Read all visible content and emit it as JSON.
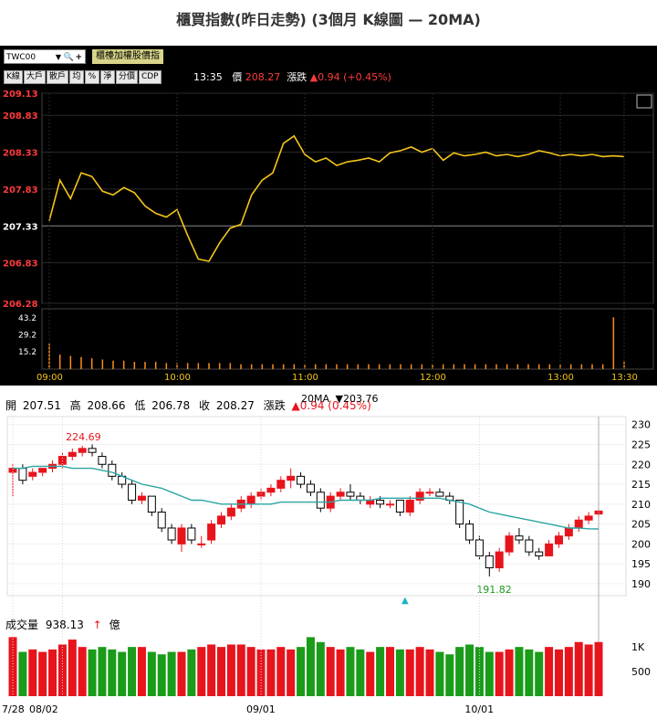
{
  "title": "櫃買指數(昨日走勢) (3個月 K線圖 — 20MA)",
  "intraday": {
    "symbol": "TWC00",
    "index_name": "櫃檯加權股價指",
    "buttons": [
      "K線",
      "大戶",
      "散戶",
      "均",
      "%",
      "淨",
      "分價",
      "CDP"
    ],
    "time": "13:35",
    "price_label": "價",
    "price": "208.27",
    "change_label": "漲跌",
    "change": "▲0.94 (+0.45%)",
    "colors": {
      "line": "#f5c518",
      "red": "#ff3b3b",
      "grid": "#2a2a2a",
      "volume": "#ff8c1a"
    }
  },
  "daily": {
    "ohlc_text": {
      "open_label": "開",
      "open": "207.51",
      "high_label": "高",
      "high": "208.66",
      "low_label": "低",
      "low": "206.78",
      "close_label": "收",
      "close": "208.27",
      "change_label": "漲跌",
      "change": "▲0.94 (0.45%)"
    },
    "ma_label": "20MA",
    "ma_value": "▼203.76",
    "volume_label": "成交量",
    "volume_value": "938.13",
    "volume_unit": "億",
    "colors": {
      "up": "#e8141c",
      "down": "#1a9c1a",
      "ma": "#2aa4a4"
    }
  },
  "chart_data": [
    {
      "type": "line",
      "title": "",
      "x_ticks": [
        "09:00",
        "10:00",
        "11:00",
        "12:00",
        "13:00",
        "13:30"
      ],
      "y_ticks": [
        "209.13",
        "208.83",
        "208.33",
        "207.83",
        "207.33",
        "206.83",
        "206.28"
      ],
      "reference": 207.33,
      "ylim": [
        206.28,
        209.13
      ],
      "x": [
        0,
        5,
        10,
        15,
        20,
        25,
        30,
        35,
        40,
        45,
        50,
        55,
        60,
        65,
        70,
        75,
        80,
        85,
        90,
        95,
        100,
        105,
        110,
        115,
        120,
        125,
        130,
        135,
        140,
        145,
        150,
        155,
        160,
        165,
        170,
        175,
        180,
        185,
        190,
        195,
        200,
        205,
        210,
        215,
        220,
        225,
        230,
        235,
        240,
        245,
        250,
        255,
        260,
        265,
        270
      ],
      "values": [
        207.4,
        207.95,
        207.7,
        208.05,
        208.0,
        207.8,
        207.75,
        207.85,
        207.78,
        207.6,
        207.5,
        207.45,
        207.55,
        207.2,
        206.88,
        206.85,
        207.1,
        207.3,
        207.35,
        207.75,
        207.95,
        208.05,
        208.45,
        208.55,
        208.3,
        208.2,
        208.25,
        208.15,
        208.2,
        208.22,
        208.25,
        208.2,
        208.32,
        208.35,
        208.4,
        208.33,
        208.38,
        208.22,
        208.32,
        208.28,
        208.3,
        208.33,
        208.28,
        208.3,
        208.27,
        208.3,
        208.35,
        208.32,
        208.28,
        208.3,
        208.28,
        208.3,
        208.27,
        208.28,
        208.27
      ],
      "volume": {
        "y_ticks": [
          "43.2",
          "29.2",
          "15.2"
        ],
        "ylim": [
          0,
          50
        ],
        "values": [
          21,
          12,
          11,
          10,
          9,
          8,
          7,
          7,
          6,
          6,
          6,
          5,
          5,
          5,
          5,
          5,
          5,
          5,
          4,
          4,
          4,
          4,
          4,
          4,
          4,
          4,
          4,
          4,
          4,
          4,
          4,
          4,
          4,
          4,
          4,
          4,
          4,
          4,
          4,
          4,
          4,
          4,
          4,
          4,
          4,
          4,
          4,
          4,
          4,
          4,
          4,
          4,
          4,
          43,
          6
        ]
      }
    },
    {
      "type": "candlestick",
      "title": "",
      "x_ticks": [
        "7/28",
        "08/02",
        "09/01",
        "10/01"
      ],
      "y_ticks": [
        "230",
        "225",
        "220",
        "215",
        "210",
        "205",
        "200",
        "195",
        "190"
      ],
      "ylim": [
        187,
        232
      ],
      "annotations": [
        {
          "label": "224.69",
          "value": 224.69
        },
        {
          "label": "191.82",
          "value": 191.82
        }
      ],
      "candles": [
        [
          218,
          220,
          212,
          219
        ],
        [
          219,
          220,
          215,
          216
        ],
        [
          217,
          219,
          216,
          218
        ],
        [
          218,
          219,
          217,
          219
        ],
        [
          219,
          221,
          218,
          220
        ],
        [
          220,
          223,
          219,
          222
        ],
        [
          222,
          224,
          221,
          223
        ],
        [
          223,
          224.69,
          222,
          224
        ],
        [
          224,
          225,
          222,
          223
        ],
        [
          222,
          223,
          219,
          220
        ],
        [
          220,
          221,
          216,
          217
        ],
        [
          217,
          218,
          214,
          215
        ],
        [
          215,
          216,
          210,
          211
        ],
        [
          211,
          213,
          210,
          212
        ],
        [
          212,
          212,
          207,
          208
        ],
        [
          208,
          209,
          203,
          204
        ],
        [
          204,
          205,
          200,
          201
        ],
        [
          200,
          205,
          198,
          204
        ],
        [
          204,
          205,
          200,
          201
        ],
        [
          200,
          202,
          199,
          200
        ],
        [
          201,
          206,
          200,
          205
        ],
        [
          205,
          208,
          204,
          207
        ],
        [
          207,
          210,
          206,
          209
        ],
        [
          209,
          212,
          208,
          211
        ],
        [
          210,
          213,
          209,
          212
        ],
        [
          212,
          214,
          211,
          213
        ],
        [
          213,
          215,
          212,
          214
        ],
        [
          214,
          217,
          213,
          216
        ],
        [
          216,
          219,
          214,
          217
        ],
        [
          217,
          218,
          214,
          215
        ],
        [
          215,
          216,
          212,
          213
        ],
        [
          213,
          214,
          208,
          209
        ],
        [
          209,
          213,
          208,
          212
        ],
        [
          212,
          214,
          211,
          213
        ],
        [
          213,
          215,
          211,
          212
        ],
        [
          212,
          213,
          210,
          211
        ],
        [
          210,
          212,
          209,
          211
        ],
        [
          211,
          212,
          209,
          210
        ],
        [
          210,
          211,
          209,
          210
        ],
        [
          211,
          211,
          207,
          208
        ],
        [
          208,
          212,
          207,
          211
        ],
        [
          211,
          214,
          210,
          213
        ],
        [
          213,
          214,
          212,
          213
        ],
        [
          213,
          214,
          212,
          212
        ],
        [
          212,
          213,
          210,
          211
        ],
        [
          211,
          211,
          204,
          205
        ],
        [
          205,
          206,
          200,
          201
        ],
        [
          201,
          202,
          196,
          197
        ],
        [
          197,
          198,
          191.82,
          194
        ],
        [
          194,
          199,
          193,
          198
        ],
        [
          198,
          203,
          197,
          202
        ],
        [
          202,
          204,
          200,
          201
        ],
        [
          201,
          202,
          197,
          198
        ],
        [
          198,
          199,
          196,
          197
        ],
        [
          197,
          201,
          197,
          200
        ],
        [
          200,
          203,
          199,
          202
        ],
        [
          202,
          205,
          201,
          204
        ],
        [
          204,
          207,
          203,
          206
        ],
        [
          206,
          208,
          205,
          207
        ],
        [
          207.51,
          208.66,
          206.78,
          208.27
        ]
      ],
      "ma20": [
        219,
        219,
        219.5,
        219.5,
        219.5,
        219.5,
        219,
        219,
        219,
        218.5,
        218,
        217,
        216,
        215,
        214.5,
        214,
        213,
        212,
        211,
        211,
        210.5,
        210,
        210,
        210,
        210,
        210,
        210,
        210.5,
        210.5,
        210.5,
        210.5,
        210.5,
        210.5,
        211,
        211,
        211,
        211,
        211.5,
        211.5,
        211.5,
        211.5,
        211.5,
        211.5,
        211.5,
        211,
        210.5,
        210,
        209,
        208,
        207.5,
        207,
        206.5,
        206,
        205.5,
        205,
        204.5,
        204,
        204,
        203.8,
        203.76
      ],
      "volume": {
        "y_ticks": [
          "1K",
          "500"
        ],
        "ylim": [
          0,
          1300
        ],
        "values": [
          1200,
          900,
          950,
          900,
          950,
          1050,
          1150,
          1000,
          950,
          1000,
          950,
          900,
          1000,
          1000,
          900,
          850,
          900,
          900,
          950,
          1000,
          1050,
          1000,
          1050,
          1050,
          1000,
          950,
          950,
          1000,
          950,
          1000,
          1200,
          1100,
          1000,
          950,
          1000,
          950,
          900,
          1000,
          1000,
          950,
          950,
          1000,
          950,
          900,
          850,
          1000,
          1050,
          1000,
          900,
          900,
          950,
          1000,
          950,
          900,
          1000,
          950,
          1000,
          1100,
          1050,
          1100
        ]
      }
    }
  ]
}
